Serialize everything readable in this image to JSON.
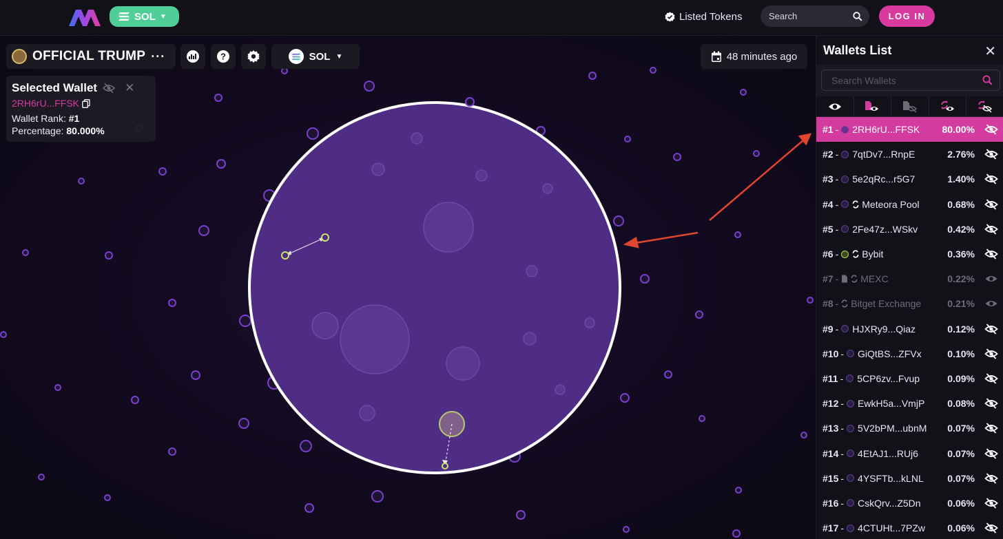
{
  "topbar": {
    "chain_label": "SOL",
    "listed_tokens_label": "Listed Tokens",
    "search_placeholder": "Search",
    "login_label": "LOG IN"
  },
  "token_bar": {
    "token_name": "OFFICIAL TRUMP",
    "more_label": "···",
    "chain_label": "SOL",
    "updated_label": "48 minutes ago"
  },
  "selected_wallet": {
    "title": "Selected Wallet",
    "address": "2RH6rU...FFSK",
    "rank_label": "Wallet Rank:",
    "rank_value": "#1",
    "percentage_label": "Percentage:",
    "percentage_value": "80.000%"
  },
  "wallets_panel": {
    "title": "Wallets List",
    "search_placeholder": "Search Wallets",
    "filter_icons": [
      "eye-icon",
      "contract-eye-icon",
      "contract-eye-off-icon",
      "exchange-eye-icon",
      "exchange-eye-off-icon"
    ],
    "accent_color": "#d43b9e",
    "wallets": [
      {
        "rank": "#1",
        "name": "2RH6rU...FFSK",
        "pct": "80.00%",
        "state": "active",
        "tag": "dot",
        "visible": false
      },
      {
        "rank": "#2",
        "name": "7qtDv7...RnpE",
        "pct": "2.76%",
        "state": "normal",
        "tag": "dot",
        "visible": false
      },
      {
        "rank": "#3",
        "name": "5e2qRc...r5G7",
        "pct": "1.40%",
        "state": "normal",
        "tag": "dot",
        "visible": false
      },
      {
        "rank": "#4",
        "name": "Meteora Pool",
        "pct": "0.68%",
        "state": "normal",
        "tag": "dot-exchange",
        "visible": false
      },
      {
        "rank": "#5",
        "name": "2Fe47z...WSkv",
        "pct": "0.42%",
        "state": "normal",
        "tag": "dot",
        "visible": false
      },
      {
        "rank": "#6",
        "name": "Bybit",
        "pct": "0.36%",
        "state": "normal",
        "tag": "greendot-exchange",
        "visible": false
      },
      {
        "rank": "#7",
        "name": "MEXC",
        "pct": "0.22%",
        "state": "dim",
        "tag": "contract-exchange",
        "visible": true
      },
      {
        "rank": "#8",
        "name": "Bitget Exchange",
        "pct": "0.21%",
        "state": "dim",
        "tag": "exchange",
        "visible": true
      },
      {
        "rank": "#9",
        "name": "HJXRy9...Qiaz",
        "pct": "0.12%",
        "state": "normal",
        "tag": "dot",
        "visible": false
      },
      {
        "rank": "#10",
        "name": "GiQtBS...ZFVx",
        "pct": "0.10%",
        "state": "normal",
        "tag": "dot",
        "visible": false
      },
      {
        "rank": "#11",
        "name": "5CP6zv...Fvup",
        "pct": "0.09%",
        "state": "normal",
        "tag": "dot",
        "visible": false
      },
      {
        "rank": "#12",
        "name": "EwkH5a...VmjP",
        "pct": "0.08%",
        "state": "normal",
        "tag": "dot",
        "visible": false
      },
      {
        "rank": "#13",
        "name": "5V2bPM...ubnM",
        "pct": "0.07%",
        "state": "normal",
        "tag": "dot",
        "visible": false
      },
      {
        "rank": "#14",
        "name": "4EtAJ1...RUj6",
        "pct": "0.07%",
        "state": "normal",
        "tag": "dot",
        "visible": false
      },
      {
        "rank": "#15",
        "name": "4YSFTb...kLNL",
        "pct": "0.07%",
        "state": "normal",
        "tag": "dot",
        "visible": false
      },
      {
        "rank": "#16",
        "name": "CskQrv...Z5Dn",
        "pct": "0.06%",
        "state": "normal",
        "tag": "dot",
        "visible": false
      },
      {
        "rank": "#17",
        "name": "4CTUHt...7PZw",
        "pct": "0.06%",
        "state": "normal",
        "tag": "dot",
        "visible": false
      }
    ]
  },
  "map": {
    "main_bubble_color": "#4f2d84",
    "small_bubble_color": "#7b3fd0",
    "highlight_bubble_color": "#c9e66a"
  }
}
